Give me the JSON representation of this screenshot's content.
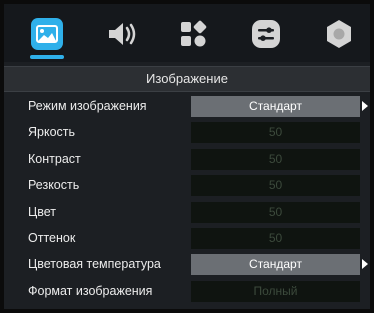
{
  "header": {
    "title": "Изображение"
  },
  "tabs": [
    {
      "icon": "picture-icon",
      "active": true
    },
    {
      "icon": "speaker-icon",
      "active": false
    },
    {
      "icon": "apps-icon",
      "active": false
    },
    {
      "icon": "settings-sliders-icon",
      "active": false
    },
    {
      "icon": "hexagon-icon",
      "active": false
    }
  ],
  "settings": [
    {
      "label": "Режим  изображения",
      "value": "Стандарт",
      "enabled": true
    },
    {
      "label": "Яркость",
      "value": "50",
      "enabled": false
    },
    {
      "label": "Контраст",
      "value": "50",
      "enabled": false
    },
    {
      "label": "Резкость",
      "value": "50",
      "enabled": false
    },
    {
      "label": "Цвет",
      "value": "50",
      "enabled": false
    },
    {
      "label": "Оттенок",
      "value": "50",
      "enabled": false
    },
    {
      "label": "Цветовая  температура",
      "value": "Стандарт",
      "enabled": true
    },
    {
      "label": "Формат  изображения",
      "value": "Полный",
      "enabled": false
    }
  ],
  "colors": {
    "accent": "#2fb0ea",
    "selectable_value_bg": "#6b6f74",
    "disabled_value_bg": "#0f1410"
  }
}
